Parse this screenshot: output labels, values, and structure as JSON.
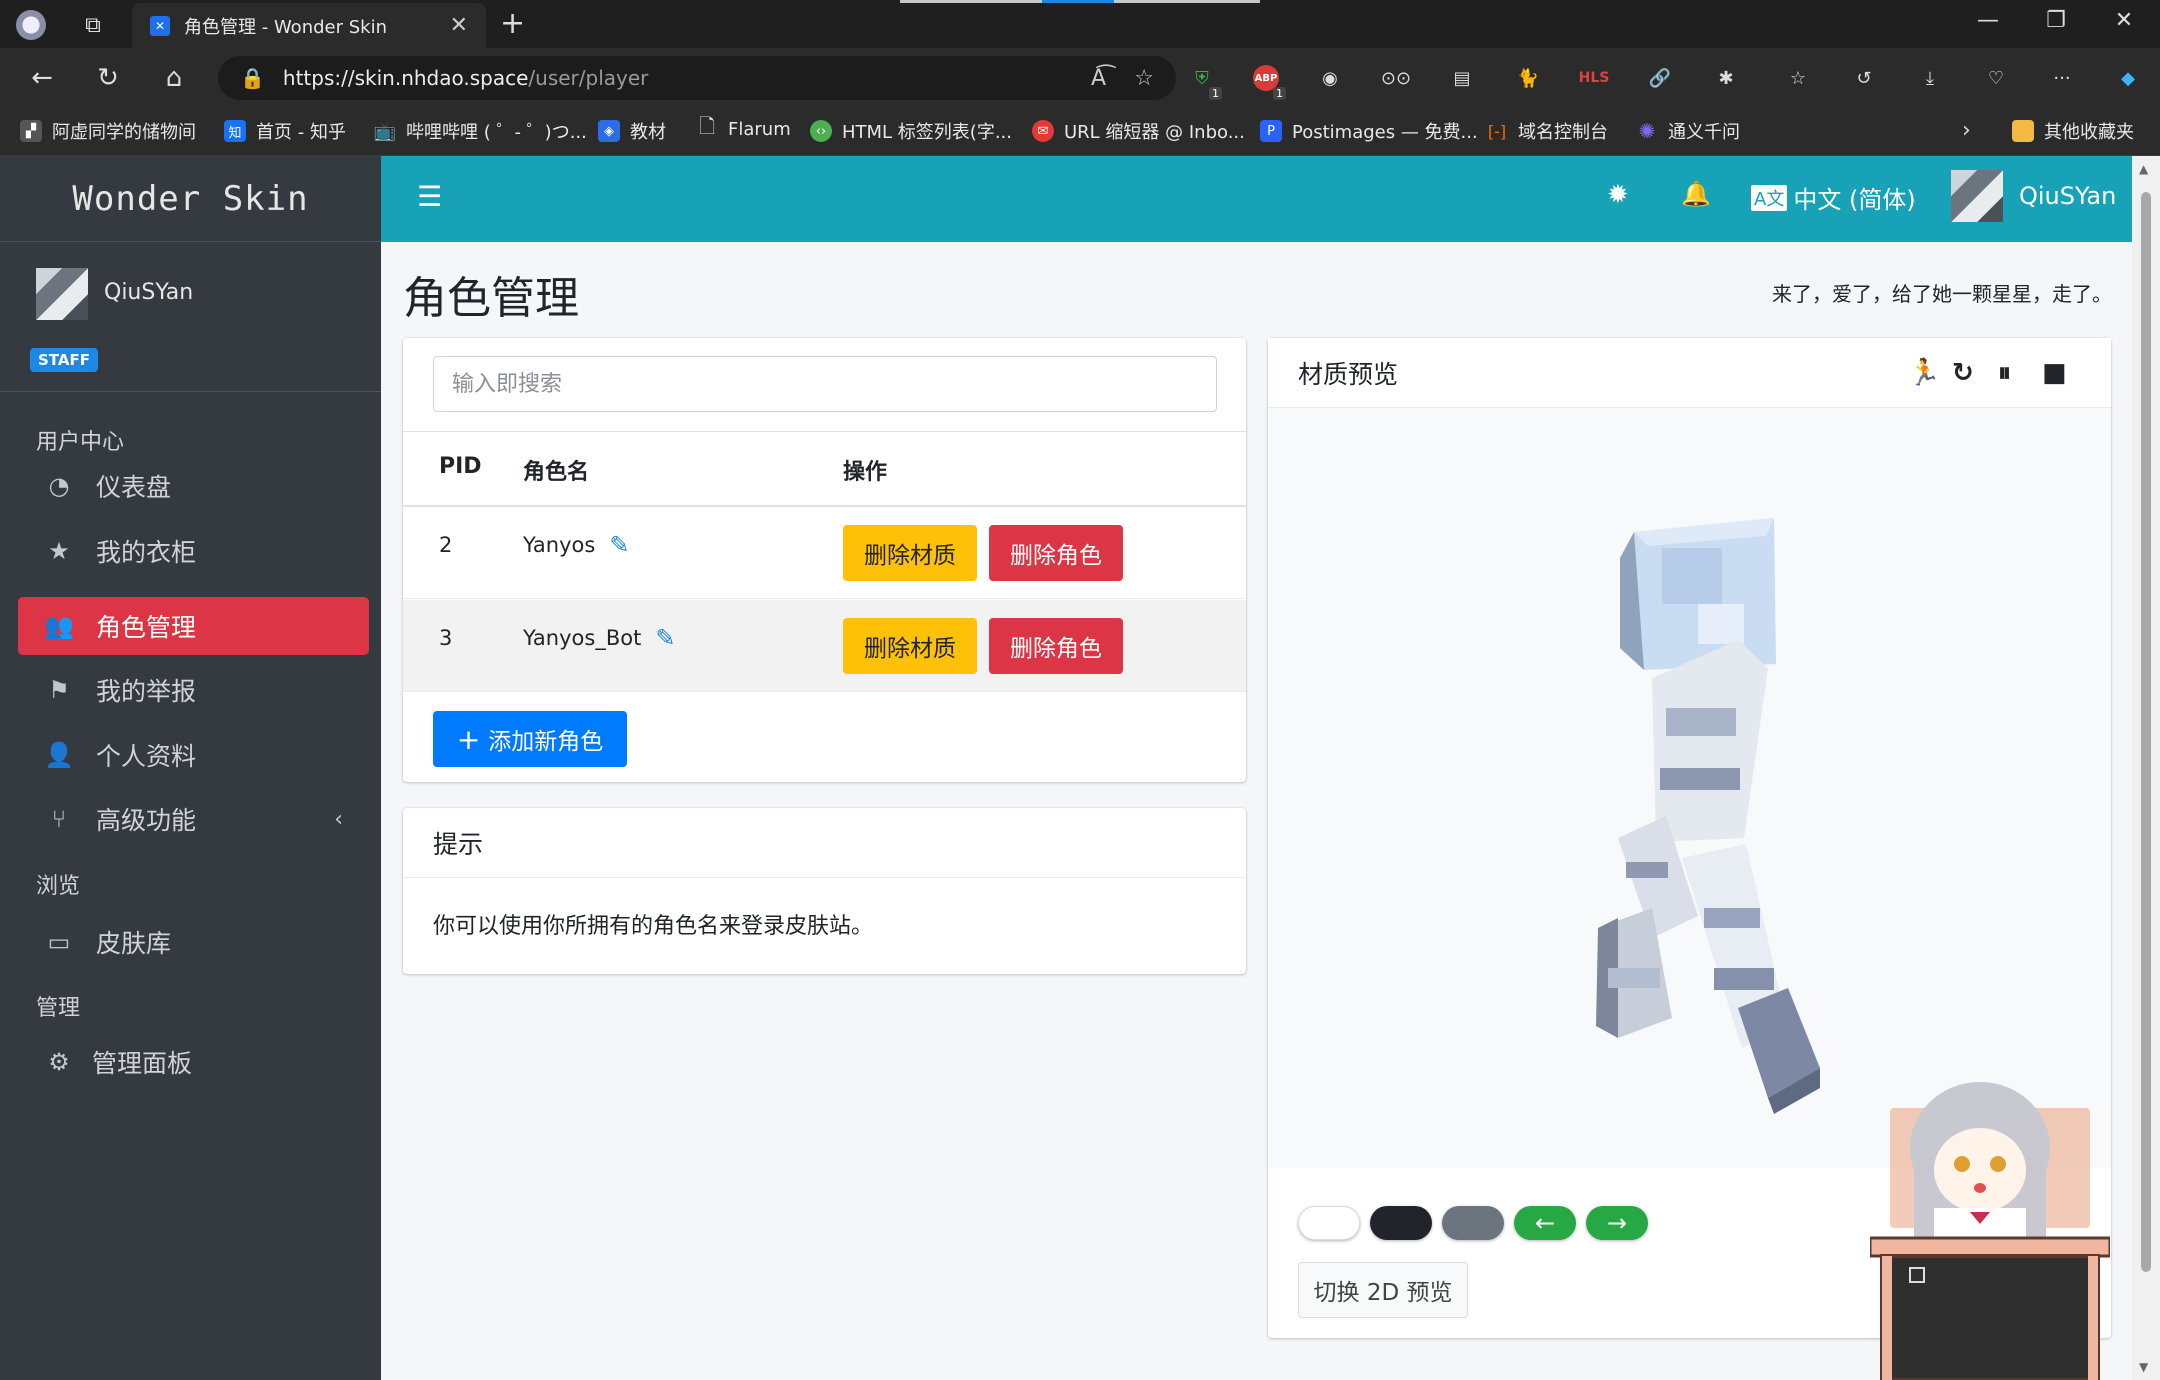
{
  "browser": {
    "tab_title": "角色管理 - Wonder Skin",
    "url_host": "https://skin.nhdao.space",
    "url_path": "/user/player",
    "bookmarks": [
      "阿虚同学的储物间",
      "首页 - 知乎",
      "哔哩哔哩 ( ゜- ゜)つ...",
      "教材",
      "Flarum",
      "HTML 标签列表(字...",
      "URL 缩短器 @ Inbo...",
      "Postimages — 免费...",
      "域名控制台",
      "通义千问"
    ],
    "other_bookmarks": "其他收藏夹",
    "ext_badge_1": "1",
    "ext_badge_2": "1",
    "hls_label": "HLS"
  },
  "sidebar": {
    "brand": "Wonder Skin",
    "user_name": "QiuSYan",
    "badge": "STAFF",
    "section_user_center": "用户中心",
    "items": [
      {
        "label": "仪表盘",
        "icon": "dashboard-icon"
      },
      {
        "label": "我的衣柜",
        "icon": "star-icon"
      },
      {
        "label": "角色管理",
        "icon": "users-icon",
        "active": true
      },
      {
        "label": "我的举报",
        "icon": "flag-icon"
      },
      {
        "label": "个人资料",
        "icon": "user-icon"
      },
      {
        "label": "高级功能",
        "icon": "code-branch-icon"
      }
    ],
    "section_browse": "浏览",
    "browse_items": [
      {
        "label": "皮肤库",
        "icon": "archive-icon"
      }
    ],
    "section_admin": "管理",
    "admin_items": [
      {
        "label": "管理面板",
        "icon": "gear-icon"
      }
    ]
  },
  "topnav": {
    "language": "中文 (简体)",
    "user_name": "QiuSYan"
  },
  "main": {
    "page_title": "角色管理",
    "slogan": "来了，爱了，给了她一颗星星，走了。",
    "search_placeholder": "输入即搜索",
    "table": {
      "headers": [
        "PID",
        "角色名",
        "操作"
      ],
      "rows": [
        {
          "pid": "2",
          "name": "Yanyos"
        },
        {
          "pid": "3",
          "name": "Yanyos_Bot"
        }
      ],
      "delete_texture": "删除材质",
      "delete_player": "删除角色"
    },
    "add_player": "添加新角色",
    "tip_title": "提示",
    "tip_text": "你可以使用你所拥有的角色名来登录皮肤站。",
    "preview_title": "材质预览",
    "switch_2d": "切换 2D 预览"
  },
  "colors": {
    "sidebar_bg": "#343a40",
    "topnav_bg": "#17a2b8",
    "active_item": "#dc3545",
    "warning": "#ffc107",
    "danger": "#dc3545",
    "primary": "#007bff",
    "success": "#28a745"
  }
}
